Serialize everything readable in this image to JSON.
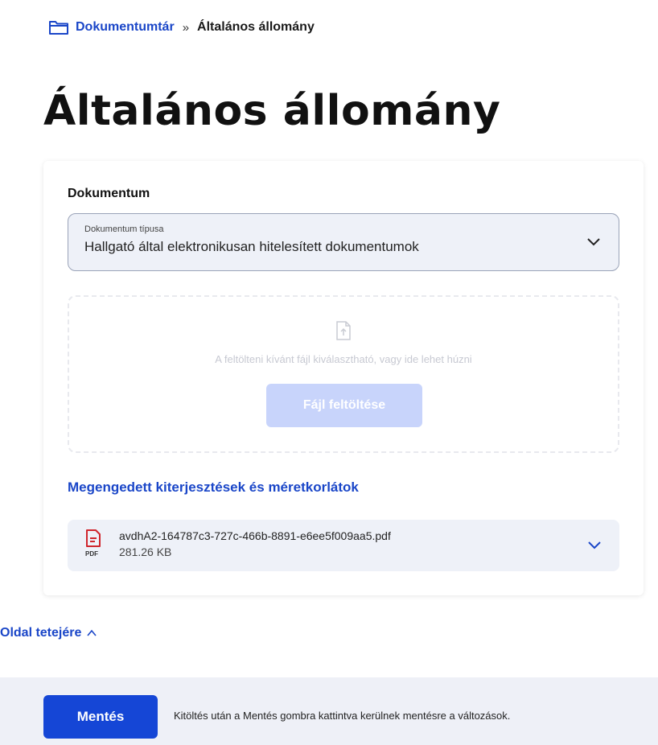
{
  "breadcrumb": {
    "root": "Dokumentumtár",
    "separator": "»",
    "current": "Általános állomány"
  },
  "page": {
    "title": "Általános állomány"
  },
  "document": {
    "section_label": "Dokumentum",
    "type_select": {
      "label": "Dokumentum típusa",
      "value": "Hallgató által elektronikusan hitelesített dokumentumok"
    },
    "upload": {
      "hint": "A feltölteni kívánt fájl kiválasztható, vagy ide lehet húzni",
      "button_label": "Fájl feltöltése"
    },
    "allowed_link": "Megengedett kiterjesztések és méretkorlátok",
    "file": {
      "type_label": "PDF",
      "name": "avdhA2-164787c3-727c-466b-8891-e6ee5f009aa5.pdf",
      "size": "281.26 KB"
    }
  },
  "nav": {
    "back_to_top": "Oldal tetejére"
  },
  "footer": {
    "save_label": "Mentés",
    "note": "Kitöltés után a Mentés gombra kattintva kerülnek mentésre a változások."
  },
  "colors": {
    "accent": "#1a46c8",
    "primary_button": "#1546d6",
    "disabled_button": "#c8d4fb",
    "field_background": "#eef1f8",
    "pdf_icon": "#d0262d"
  },
  "icons": {
    "breadcrumb": "folder-icon",
    "select": "chevron-down-icon",
    "upload": "file-upload-icon",
    "file": "pdf-file-icon",
    "file_expand": "chevron-down-icon",
    "back_to_top": "chevron-up-icon"
  }
}
